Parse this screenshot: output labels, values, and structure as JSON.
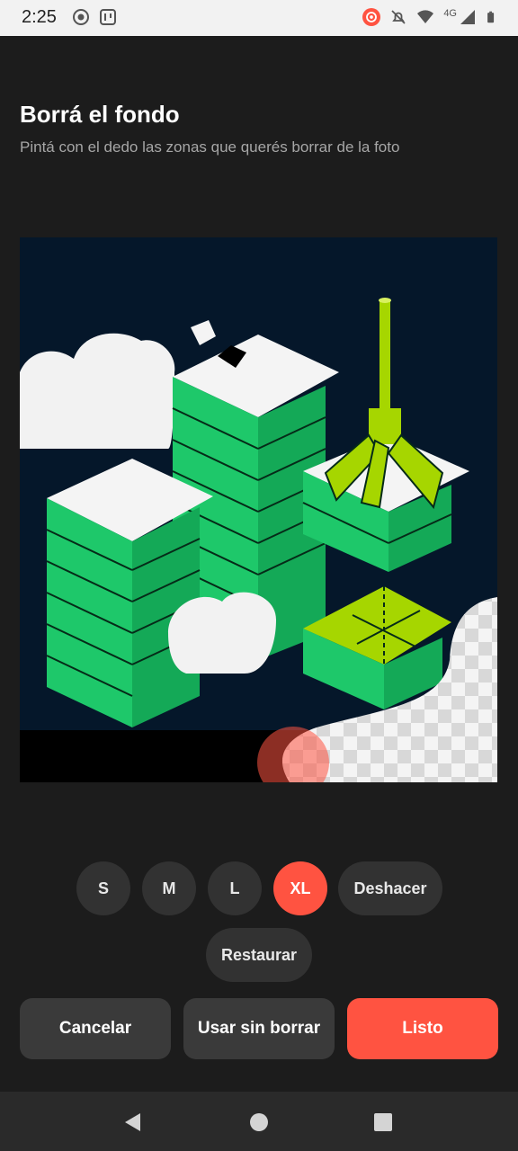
{
  "status_bar": {
    "time": "2:25",
    "network_label": "4G",
    "icons_left": [
      "media-icon",
      "app-icon"
    ],
    "icons_right": [
      "screen-record-icon",
      "bell-off-icon",
      "wifi-icon",
      "signal-icon",
      "battery-icon"
    ]
  },
  "header": {
    "title": "Borrá el fondo",
    "subtitle": "Pintá con el dedo las zonas que querés borrar de la foto"
  },
  "brush_sizes": [
    {
      "label": "S",
      "selected": false
    },
    {
      "label": "M",
      "selected": false
    },
    {
      "label": "L",
      "selected": false
    },
    {
      "label": "XL",
      "selected": true
    }
  ],
  "tools": {
    "undo_label": "Deshacer",
    "restore_label": "Restaurar"
  },
  "actions": {
    "cancel_label": "Cancelar",
    "use_without_erase_label": "Usar sin borrar",
    "done_label": "Listo"
  },
  "colors": {
    "accent": "#ff5341",
    "background": "#1c1c1c",
    "pill": "#323232",
    "illustration_green": "#1ec86a",
    "illustration_lime": "#a6d600",
    "illustration_navy": "#05172a"
  }
}
